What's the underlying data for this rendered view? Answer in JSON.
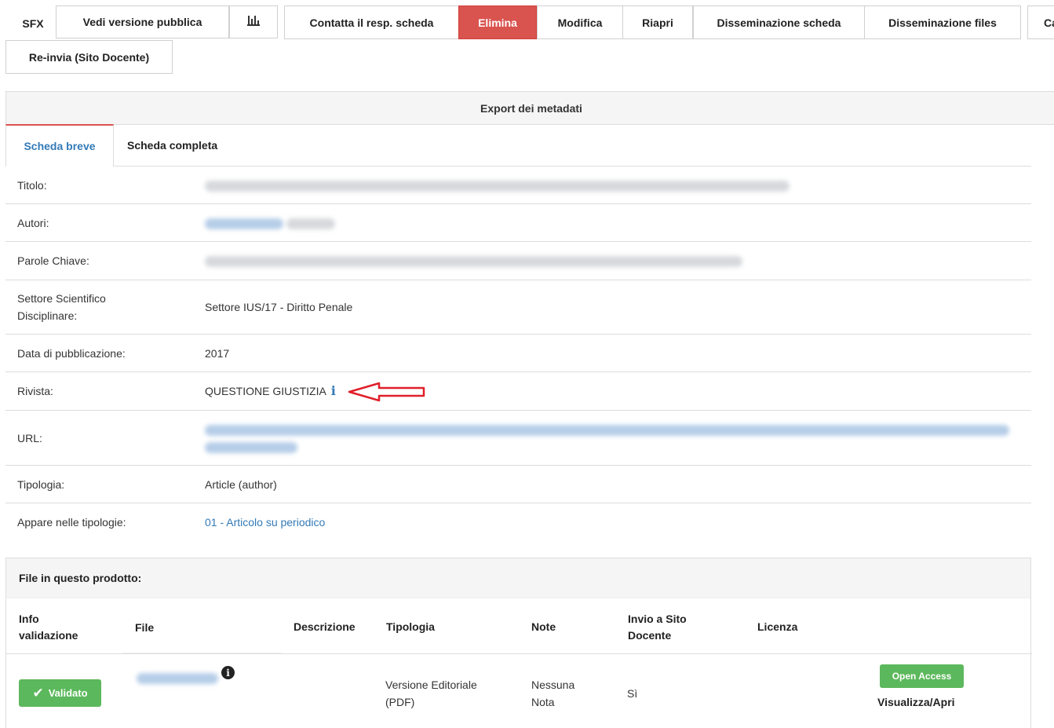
{
  "toolbar": {
    "sfx": "SFX",
    "public_version": "Vedi versione pubblica",
    "stats_icon": "bar-chart-icon",
    "contact": "Contatta il resp. scheda",
    "delete": "Elimina",
    "edit": "Modifica",
    "reopen": "Riapri",
    "dissemination_record": "Disseminazione scheda",
    "dissemination_files": "Disseminazione files",
    "truncated": "Ca",
    "resend": "Re-invia (Sito Docente)",
    "delete_color": "#d9534f"
  },
  "export": {
    "label": "Export dei metadati"
  },
  "tabs": {
    "short": "Scheda breve",
    "full": "Scheda completa"
  },
  "record": {
    "title_label": "Titolo:",
    "authors_label": "Autori:",
    "keywords_label": "Parole Chiave:",
    "ssd_label": "Settore Scientifico Disciplinare:",
    "ssd_value": "Settore IUS/17 - Diritto Penale",
    "date_label": "Data di pubblicazione:",
    "date_value": "2017",
    "journal_label": "Rivista:",
    "journal_value": "QUESTIONE GIUSTIZIA",
    "journal_info_icon": "info-icon",
    "url_label": "URL:",
    "type_label": "Tipologia:",
    "type_value": "Article (author)",
    "appears_label": "Appare nelle tipologie:",
    "appears_value": "01 - Articolo su periodico"
  },
  "files": {
    "heading": "File in questo prodotto:",
    "columns": {
      "validation": "Info validazione",
      "file": "File",
      "description": "Descrizione",
      "type": "Tipologia",
      "note": "Note",
      "send": "Invio a Sito Docente",
      "license": "Licenza"
    },
    "row": {
      "validated": "Validato",
      "type": "Versione Editoriale (PDF)",
      "note": "Nessuna Nota",
      "send": "Sì",
      "open_access": "Open Access",
      "view": "Visualizza/Apri"
    }
  },
  "colors": {
    "link": "#337ab7",
    "success": "#5cb85c",
    "annotation_arrow": "#e0202a"
  }
}
